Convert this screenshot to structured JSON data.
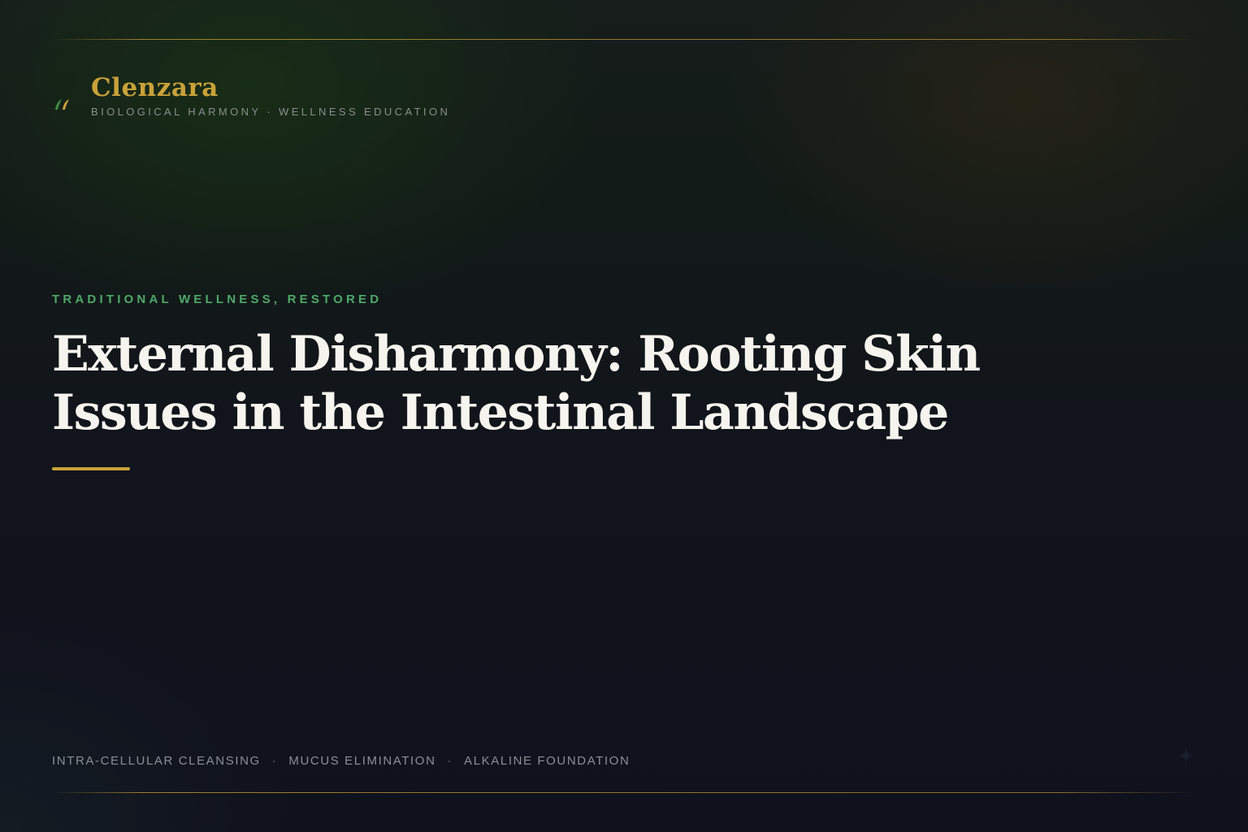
{
  "brand": {
    "name": "Clenzara",
    "tagline": "BIOLOGICAL HARMONY · WELLNESS EDUCATION",
    "logo_icon": "leaf-sprout-icon"
  },
  "hero": {
    "eyebrow": "TRADITIONAL WELLNESS, RESTORED",
    "headline": "External Disharmony: Rooting Skin Issues in the Intestinal Landscape"
  },
  "footer": {
    "pillars": [
      "INTRA-CELLULAR CLEANSING",
      "MUCUS ELIMINATION",
      "ALKALINE FOUNDATION"
    ],
    "separator": "·",
    "decor_icon": "sparkle-icon"
  },
  "colors": {
    "accent_gold": "#c9a23a",
    "accent_green": "#4fa86a",
    "headline": "#f6f4ee",
    "muted_text": "#8b8f96"
  }
}
